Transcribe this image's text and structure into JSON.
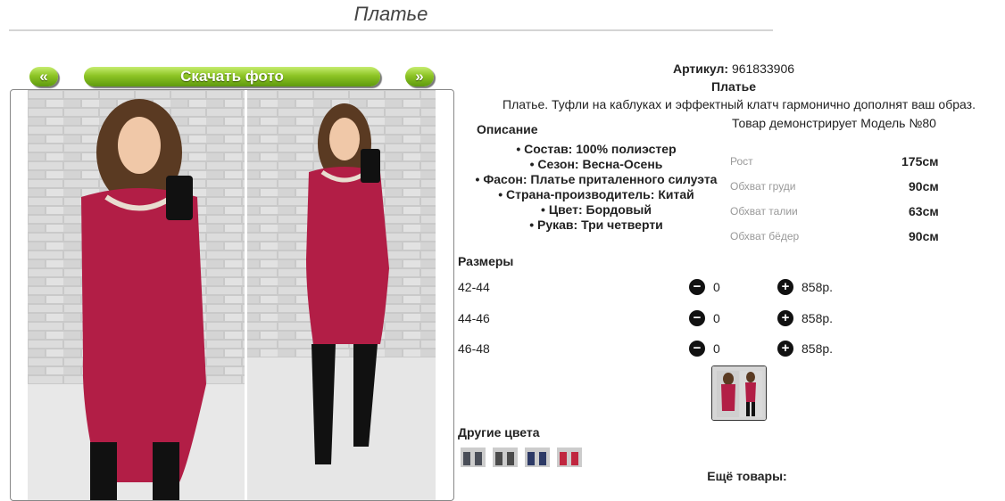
{
  "title": "Платье",
  "nav": {
    "prev": "«",
    "download": "Скачать фото",
    "next": "»"
  },
  "product": {
    "article_label": "Артикул:",
    "article": "961833906",
    "name": "Платье",
    "tagline": "Платье. Туфли на каблуках и эффектный клатч гармонично дополнят ваш образ."
  },
  "description": {
    "heading": "Описание",
    "items": [
      "Состав: 100% полиэстер",
      "Сезон: Весна-Осень",
      "Фасон: Платье приталенного силуэта",
      "Страна-производитель: Китай",
      "Цвет: Бордовый",
      "Рукав: Три четверти"
    ]
  },
  "model": {
    "heading": "Товар демонстрирует Модель №80",
    "params": [
      {
        "label": "Рост",
        "value": "175см"
      },
      {
        "label": "Обхват груди",
        "value": "90см"
      },
      {
        "label": "Обхват талии",
        "value": "63см"
      },
      {
        "label": "Обхват бёдер",
        "value": "90см"
      }
    ]
  },
  "sizes": {
    "heading": "Размеры",
    "rows": [
      {
        "size": "42-44",
        "qty": "0",
        "price": "858р."
      },
      {
        "size": "44-46",
        "qty": "0",
        "price": "858р."
      },
      {
        "size": "46-48",
        "qty": "0",
        "price": "858р."
      }
    ]
  },
  "other_colors_heading": "Другие цвета",
  "more_goods_heading": "Ещё товары:",
  "colors": {
    "dress": "#b21e46",
    "dress_dark": "#8e1535",
    "swatches": [
      "#4a4e58",
      "#4b4b4b",
      "#2d3a66",
      "#c0263f"
    ],
    "button_green": "#7ab51d"
  }
}
